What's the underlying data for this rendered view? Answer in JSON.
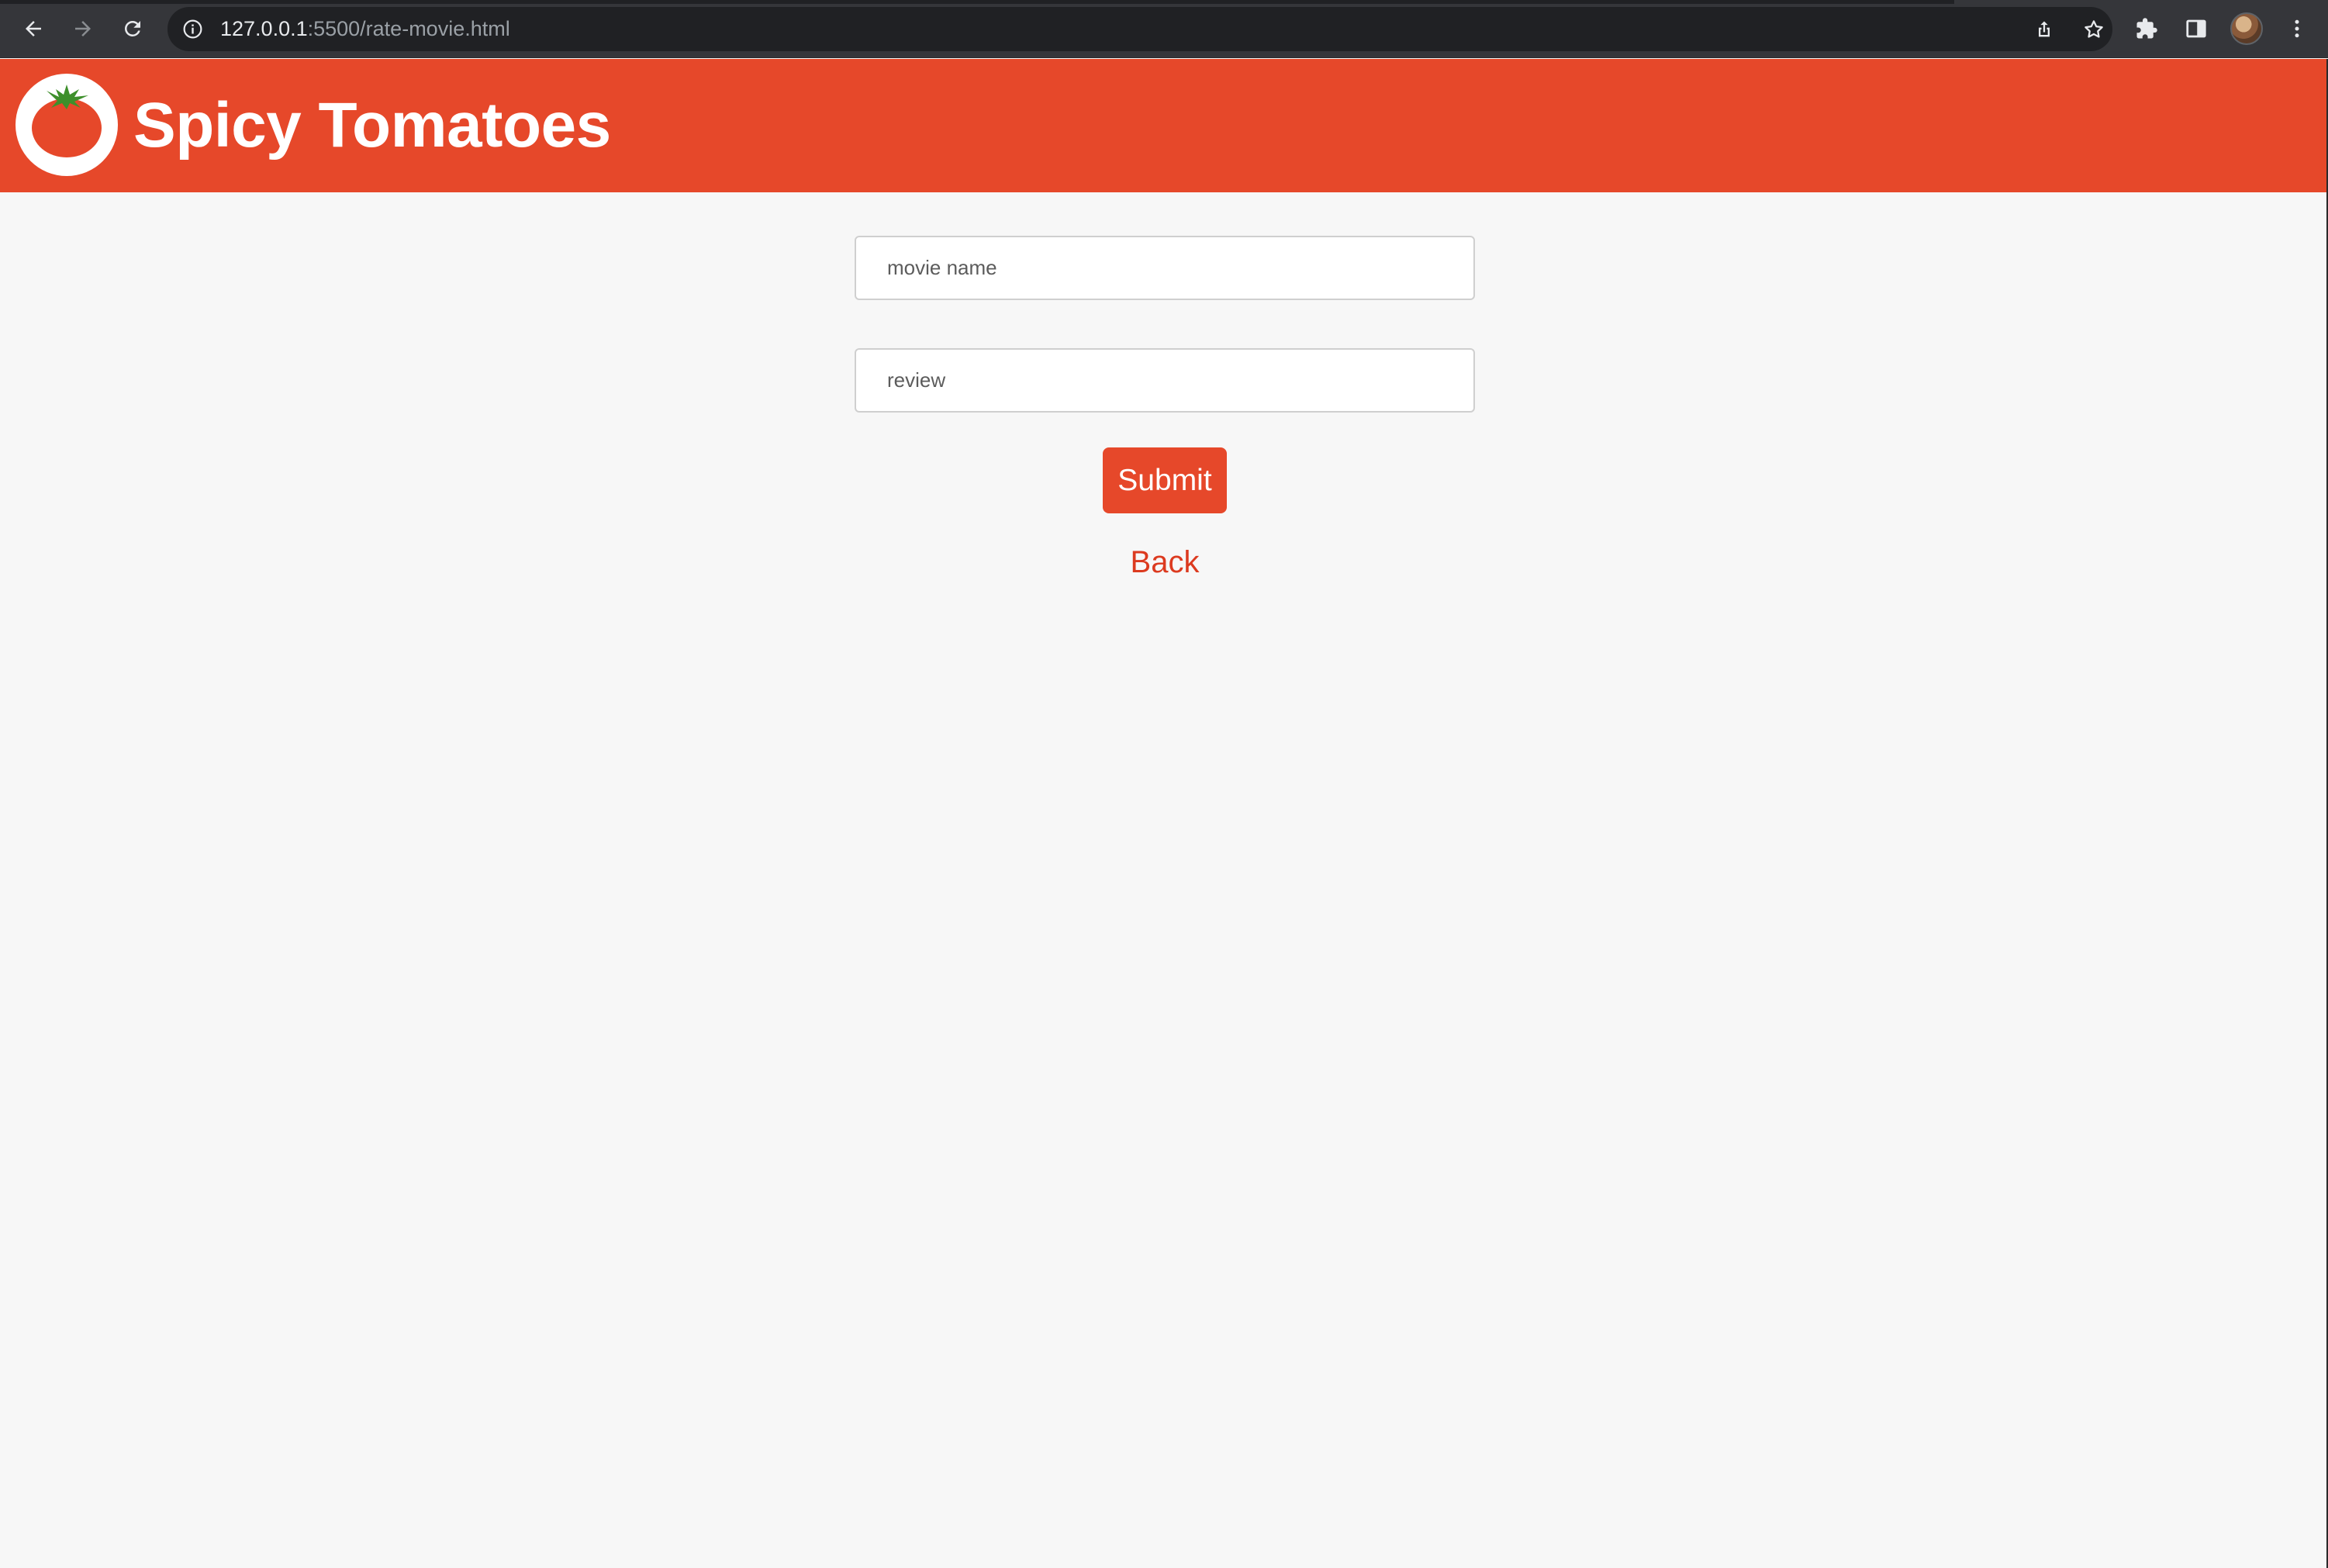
{
  "browser": {
    "url_host": "127.0.0.1",
    "url_path": ":5500/rate-movie.html",
    "icons": [
      "back-arrow-icon",
      "forward-arrow-icon",
      "reload-icon",
      "site-info-icon",
      "share-icon",
      "bookmark-star-icon",
      "extensions-puzzle-icon",
      "side-panel-icon",
      "profile-avatar",
      "kebab-menu-icon"
    ]
  },
  "header": {
    "title": "Spicy Tomatoes",
    "background_color": "#e6482a",
    "logo_icon": "tomato-logo-icon"
  },
  "form": {
    "movie_name": {
      "placeholder": "movie name",
      "value": ""
    },
    "review": {
      "placeholder": "review",
      "value": ""
    },
    "submit_label": "Submit",
    "back_label": "Back"
  },
  "colors": {
    "accent": "#e6482a",
    "link": "#dc3a1f",
    "page_background": "#f7f7f7"
  }
}
